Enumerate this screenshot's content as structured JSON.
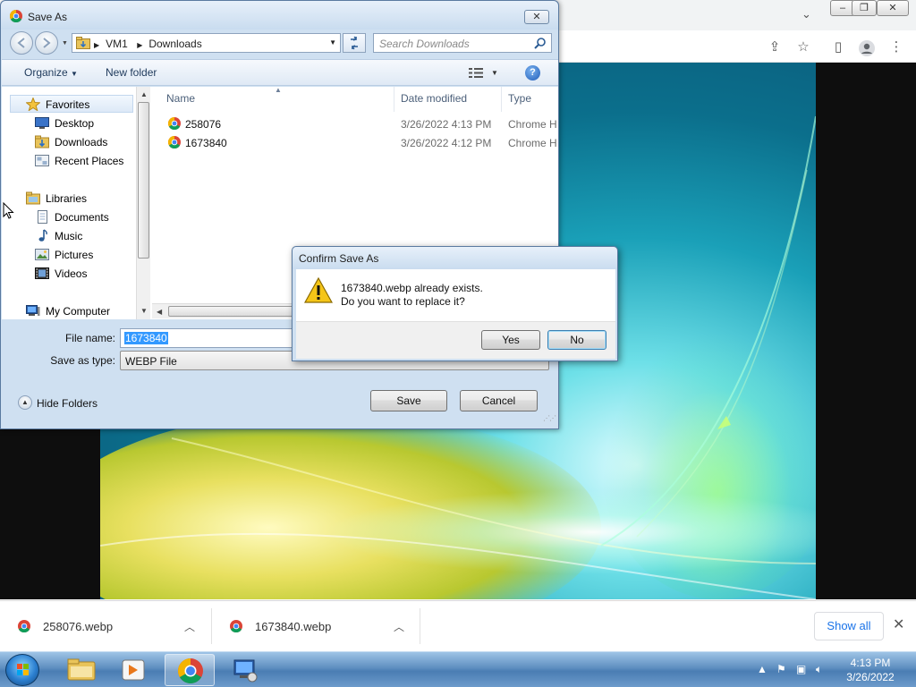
{
  "save_dialog": {
    "title": "Save As",
    "close_glyph": "✕",
    "address": {
      "segments": [
        "VM1",
        "Downloads"
      ]
    },
    "search_placeholder": "Search Downloads",
    "commands": {
      "organize": "Organize",
      "new_folder": "New folder",
      "help": "?"
    },
    "nav": {
      "favorites": "Favorites",
      "desktop": "Desktop",
      "downloads": "Downloads",
      "recent_places": "Recent Places",
      "libraries": "Libraries",
      "documents": "Documents",
      "music": "Music",
      "pictures": "Pictures",
      "videos": "Videos",
      "my_computer": "My Computer"
    },
    "columns": {
      "name": "Name",
      "date_modified": "Date modified",
      "type": "Type"
    },
    "files": [
      {
        "name": "258076",
        "date": "3/26/2022 4:13 PM",
        "type": "Chrome H"
      },
      {
        "name": "1673840",
        "date": "3/26/2022 4:12 PM",
        "type": "Chrome H"
      }
    ],
    "file_name_label": "File name:",
    "file_name_value": "1673840",
    "save_as_type_label": "Save as type:",
    "save_as_type_value": "WEBP File",
    "hide_folders": "Hide Folders",
    "save_button": "Save",
    "cancel_button": "Cancel"
  },
  "confirm_dialog": {
    "title": "Confirm Save As",
    "message_line1": "1673840.webp already exists.",
    "message_line2": "Do you want to replace it?",
    "yes": "Yes",
    "no": "No"
  },
  "downloads_bar": {
    "items": [
      {
        "name": "258076.webp"
      },
      {
        "name": "1673840.webp"
      }
    ],
    "show_all": "Show all",
    "close": "✕"
  },
  "browser": {
    "window_buttons": {
      "minimize": "–",
      "maximize": "❐",
      "close": "✕"
    }
  },
  "taskbar": {
    "time": "4:13 PM",
    "date": "3/26/2022"
  },
  "colors": {
    "link_blue": "#1a73e8",
    "selection_blue": "#3399ff",
    "dialog_frame": "#cfe0f1"
  }
}
